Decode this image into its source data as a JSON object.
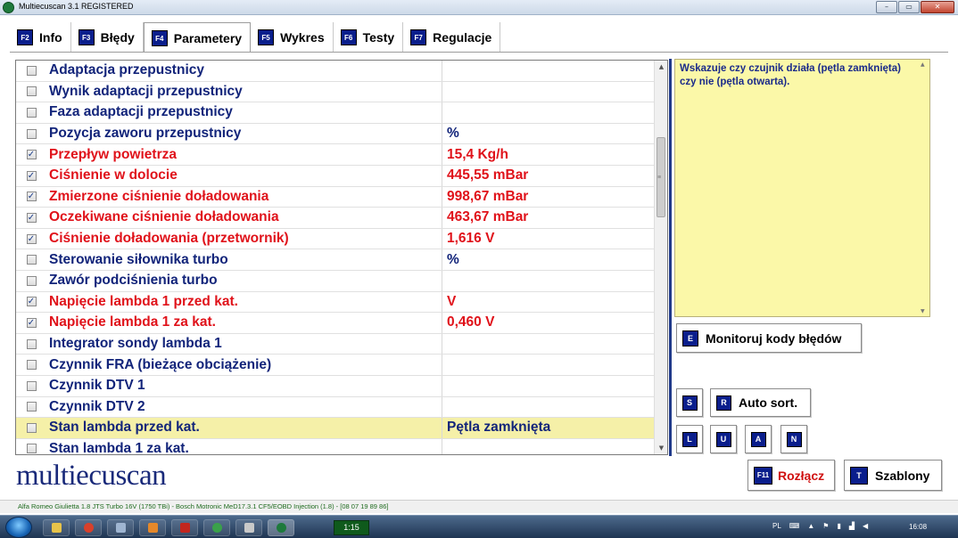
{
  "window": {
    "title": "Multiecuscan 3.1 REGISTERED",
    "controls": [
      "–",
      "▭",
      "✕"
    ]
  },
  "tabs": [
    {
      "key": "F2",
      "label": "Info",
      "active": false
    },
    {
      "key": "F3",
      "label": "Błędy",
      "active": false
    },
    {
      "key": "F4",
      "label": "Parametery",
      "active": true
    },
    {
      "key": "F5",
      "label": "Wykres",
      "active": false
    },
    {
      "key": "F6",
      "label": "Testy",
      "active": false
    },
    {
      "key": "F7",
      "label": "Regulacje",
      "active": false
    }
  ],
  "parameters": [
    {
      "checked": false,
      "name": "Adaptacja przepustnicy",
      "value": ""
    },
    {
      "checked": false,
      "name": "Wynik adaptacji przepustnicy",
      "value": ""
    },
    {
      "checked": false,
      "name": "Faza adaptacji przepustnicy",
      "value": ""
    },
    {
      "checked": false,
      "name": "Pozycja zaworu przepustnicy",
      "value": "%"
    },
    {
      "checked": true,
      "name": "Przepływ powietrza",
      "value": "15,4 Kg/h"
    },
    {
      "checked": true,
      "name": "Ciśnienie w dolocie",
      "value": "445,55 mBar"
    },
    {
      "checked": true,
      "name": "Zmierzone ciśnienie doładowania",
      "value": "998,67 mBar"
    },
    {
      "checked": true,
      "name": "Oczekiwane ciśnienie doładowania",
      "value": "463,67 mBar"
    },
    {
      "checked": true,
      "name": "Ciśnienie doładowania (przetwornik)",
      "value": "1,616 V"
    },
    {
      "checked": false,
      "name": "Sterowanie siłownika turbo",
      "value": "%"
    },
    {
      "checked": false,
      "name": "Zawór podciśnienia turbo",
      "value": ""
    },
    {
      "checked": true,
      "name": "Napięcie lambda 1 przed kat.",
      "value": "V"
    },
    {
      "checked": true,
      "name": "Napięcie lambda 1 za kat.",
      "value": "0,460 V"
    },
    {
      "checked": false,
      "name": "Integrator sondy lambda 1",
      "value": ""
    },
    {
      "checked": false,
      "name": "Czynnik FRA (bieżące obciążenie)",
      "value": ""
    },
    {
      "checked": false,
      "name": "Czynnik DTV 1",
      "value": ""
    },
    {
      "checked": false,
      "name": "Czynnik DTV 2",
      "value": ""
    },
    {
      "checked": false,
      "name": "Stan lambda przed kat.",
      "value": "Pętla zamknięta",
      "highlight": true
    },
    {
      "checked": false,
      "name": "Stan lambda 1 za kat.",
      "value": ""
    }
  ],
  "info_panel": {
    "text": "Wskazuje czy czujnik działa (pętla zamknięta) czy nie (pętla otwarta)."
  },
  "buttons": {
    "monitor": {
      "key": "E",
      "label": "Monitoruj kody błędów"
    },
    "s": {
      "key": "S"
    },
    "autosort": {
      "key": "R",
      "label": "Auto sort."
    },
    "l": {
      "key": "L"
    },
    "u": {
      "key": "U"
    },
    "a": {
      "key": "A"
    },
    "n": {
      "key": "N"
    },
    "disconnect": {
      "key": "F11",
      "label": "Rozłącz"
    },
    "templates": {
      "key": "T",
      "label": "Szablony"
    }
  },
  "logo": "multiecuscan",
  "status_bar": "Alfa Romeo Giulietta 1.8 JTS Turbo 16V (1750 TBi) - Bosch Motronic MeD17.3.1 CF5/EOBD Injection (1.8) - [08 07 19 89 86]",
  "taskbar": {
    "timer": "1:15",
    "lang": "PL",
    "clock": "16:08"
  },
  "colors": {
    "fkey_bg": "#0a1e8c",
    "name_normal": "#12247a",
    "name_active": "#e0121a",
    "highlight_row": "#f5f0a8",
    "info_panel_bg": "#fbf8a8",
    "disconnect_label": "#d01010"
  }
}
